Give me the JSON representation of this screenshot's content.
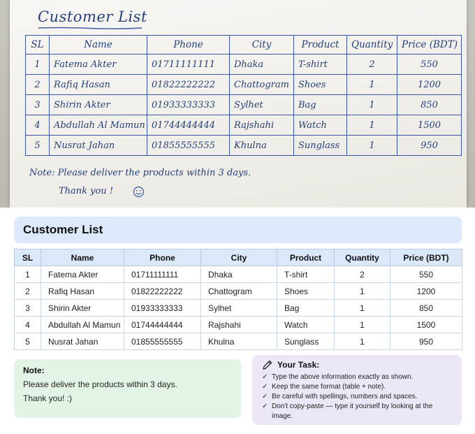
{
  "handwritten": {
    "title": "Customer List",
    "headers": [
      "SL",
      "Name",
      "Phone",
      "City",
      "Product",
      "Quantity",
      "Price (BDT)"
    ],
    "rows": [
      [
        "1",
        "Fatema Akter",
        "01711111111",
        "Dhaka",
        "T-shirt",
        "2",
        "550"
      ],
      [
        "2",
        "Rafiq Hasan",
        "01822222222",
        "Chattogram",
        "Shoes",
        "1",
        "1200"
      ],
      [
        "3",
        "Shirin Akter",
        "01933333333",
        "Sylhet",
        "Bag",
        "1",
        "850"
      ],
      [
        "4",
        "Abdullah Al Mamun",
        "01744444444",
        "Rajshahi",
        "Watch",
        "1",
        "1500"
      ],
      [
        "5",
        "Nusrat Jahan",
        "01855555555",
        "Khulna",
        "Sunglass",
        "1",
        "950"
      ]
    ],
    "note": "Note: Please deliver the products within 3 days.",
    "thanks": "Thank you !"
  },
  "typed": {
    "title": "Customer List",
    "headers": [
      "SL",
      "Name",
      "Phone",
      "City",
      "Product",
      "Quantity",
      "Price (BDT)"
    ],
    "rows": [
      [
        "1",
        "Fatema Akter",
        "01711111111",
        "Dhaka",
        "T-shirt",
        "2",
        "550"
      ],
      [
        "2",
        "Rafiq Hasan",
        "01822222222",
        "Chattogram",
        "Shoes",
        "1",
        "1200"
      ],
      [
        "3",
        "Shirin Akter",
        "01933333333",
        "Sylhet",
        "Bag",
        "1",
        "850"
      ],
      [
        "4",
        "Abdullah Al Mamun",
        "01744444444",
        "Rajshahi",
        "Watch",
        "1",
        "1500"
      ],
      [
        "5",
        "Nusrat Jahan",
        "01855555555",
        "Khulna",
        "Sunglass",
        "1",
        "950"
      ]
    ],
    "note_label": "Note:",
    "note_line": "Please deliver the products within 3 days.",
    "thanks_line": "Thank you! :)"
  },
  "task": {
    "icon": "pencil-icon",
    "title": "Your Task:",
    "items": [
      "Type the above information exactly as shown.",
      "Keep the same format (table + note).",
      "Be careful with spellings, numbers and spaces.",
      "Don't copy-paste — type it yourself by looking at the image."
    ]
  },
  "colors": {
    "ink": "#25407a",
    "title_bar": "#dde9fb",
    "table_header": "#dbe8f9",
    "note_bg": "#e3f3e5",
    "task_bg": "#ede6f6"
  }
}
